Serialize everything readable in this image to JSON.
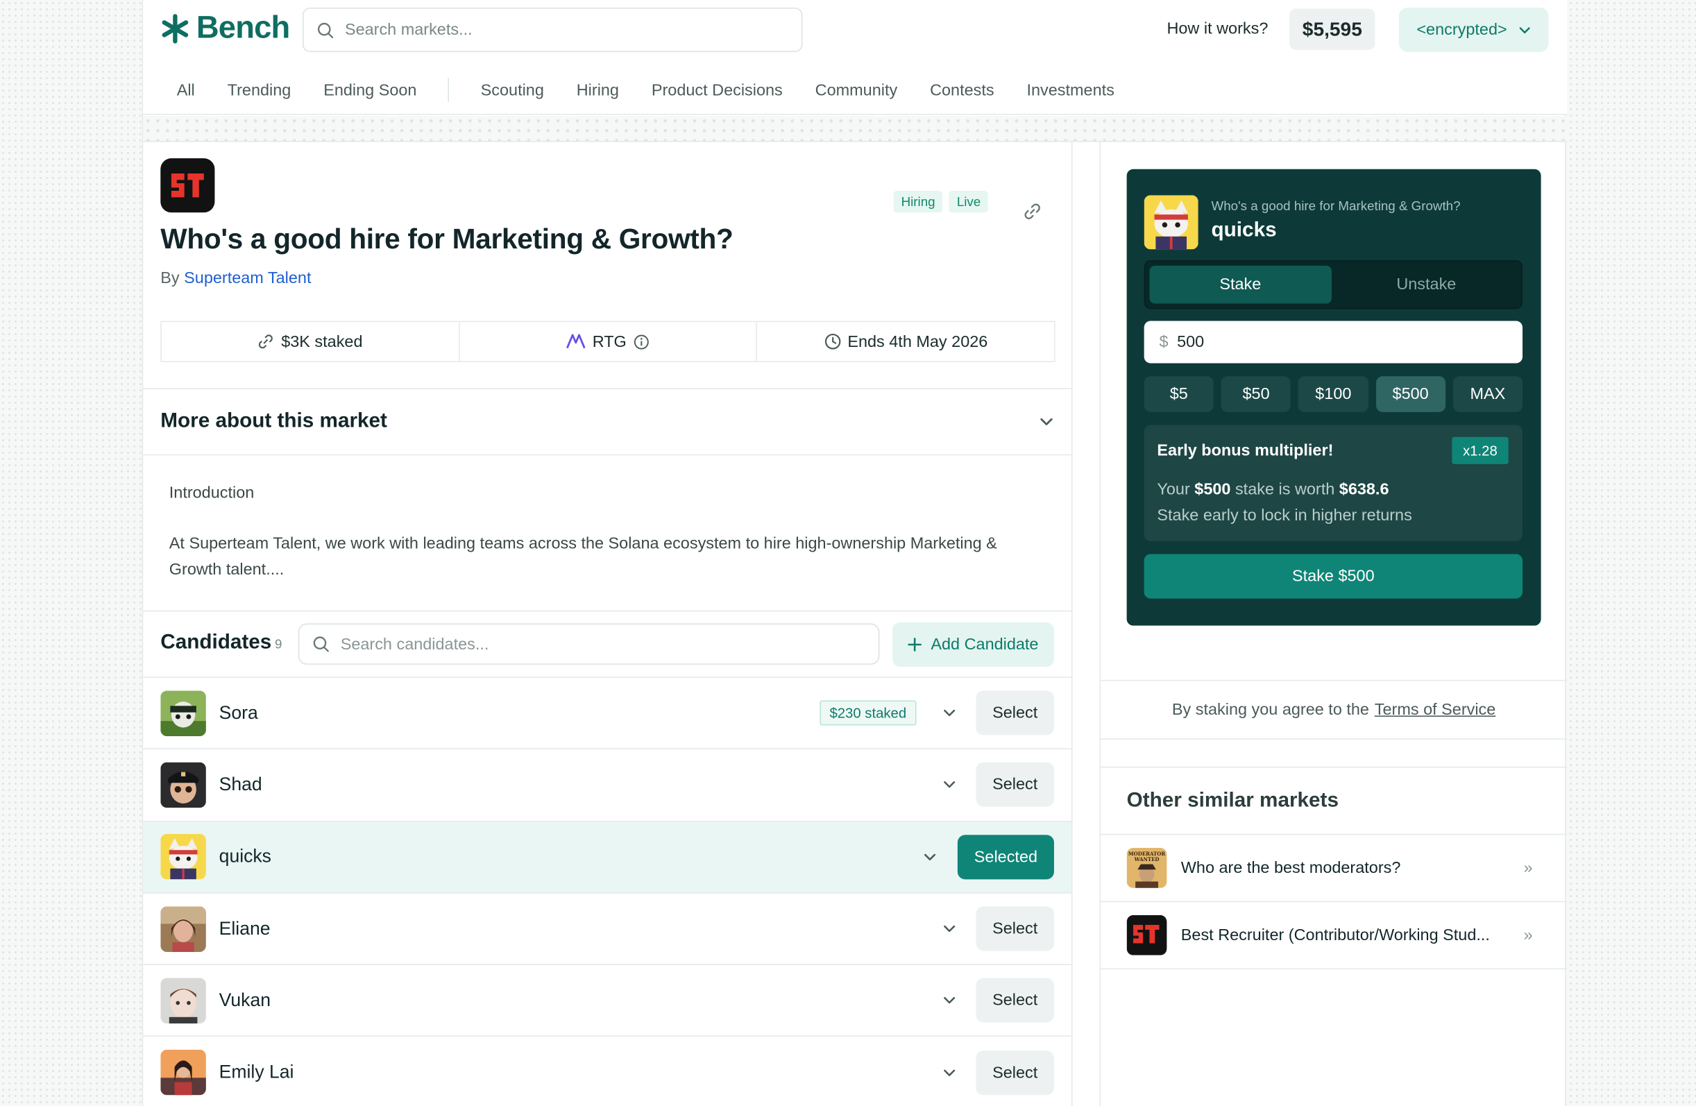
{
  "header": {
    "brand": "Bench",
    "search_placeholder": "Search markets...",
    "how_it_works": "How it works?",
    "balance": "$5,595",
    "wallet": "<encrypted>"
  },
  "nav": {
    "primary": [
      "All",
      "Trending",
      "Ending Soon"
    ],
    "categories": [
      "Scouting",
      "Hiring",
      "Product Decisions",
      "Community",
      "Contests",
      "Investments"
    ]
  },
  "market": {
    "tags": [
      "Hiring",
      "Live"
    ],
    "title": "Who's a good hire for Marketing & Growth?",
    "by_label": "By",
    "author": "Superteam Talent",
    "stats": {
      "staked": "$3K staked",
      "token": "RTG",
      "ends": "Ends 4th May 2026"
    },
    "more_title": "More about this market",
    "intro_heading": "Introduction",
    "description": "At Superteam Talent, we work with leading teams across the Solana ecosystem to hire high-ownership Marketing & Growth talent...."
  },
  "candidates": {
    "title": "Candidates",
    "count": "9",
    "search_placeholder": "Search candidates...",
    "add_label": "Add Candidate",
    "rows": [
      {
        "name": "Sora",
        "staked": "$230 staked",
        "action": "Select"
      },
      {
        "name": "Shad",
        "staked": "",
        "action": "Select"
      },
      {
        "name": "quicks",
        "staked": "",
        "action": "Selected"
      },
      {
        "name": "Eliane",
        "staked": "",
        "action": "Select"
      },
      {
        "name": "Vukan",
        "staked": "",
        "action": "Select"
      },
      {
        "name": "Emily Lai",
        "staked": "",
        "action": "Select"
      }
    ]
  },
  "stake_panel": {
    "question": "Who's a good hire for Marketing & Growth?",
    "candidate": "quicks",
    "tabs": [
      "Stake",
      "Unstake"
    ],
    "currency_symbol": "$",
    "amount": "500",
    "quick_amounts": [
      "$5",
      "$50",
      "$100",
      "$500",
      "MAX"
    ],
    "bonus_title": "Early bonus multiplier!",
    "multiplier": "x1.28",
    "bonus_line_prefix": "Your",
    "bonus_amount": "$500",
    "bonus_line_mid": "stake is worth",
    "bonus_value": "$638.6",
    "bonus_sub": "Stake early to lock in higher returns",
    "stake_button": "Stake $500"
  },
  "terms": {
    "prefix": "By staking you agree to the",
    "link": "Terms of Service"
  },
  "similar": {
    "title": "Other similar markets",
    "items": [
      {
        "title": "Who are the best moderators?",
        "icon_text": "MODERATOR WANTED"
      },
      {
        "title": "Best Recruiter (Contributor/Working Stud..."
      }
    ]
  },
  "colors": {
    "brand": "#0e6e62",
    "accent": "#0f8577",
    "stake_card_bg": "#0d3a39",
    "link": "#1f5fd1"
  }
}
